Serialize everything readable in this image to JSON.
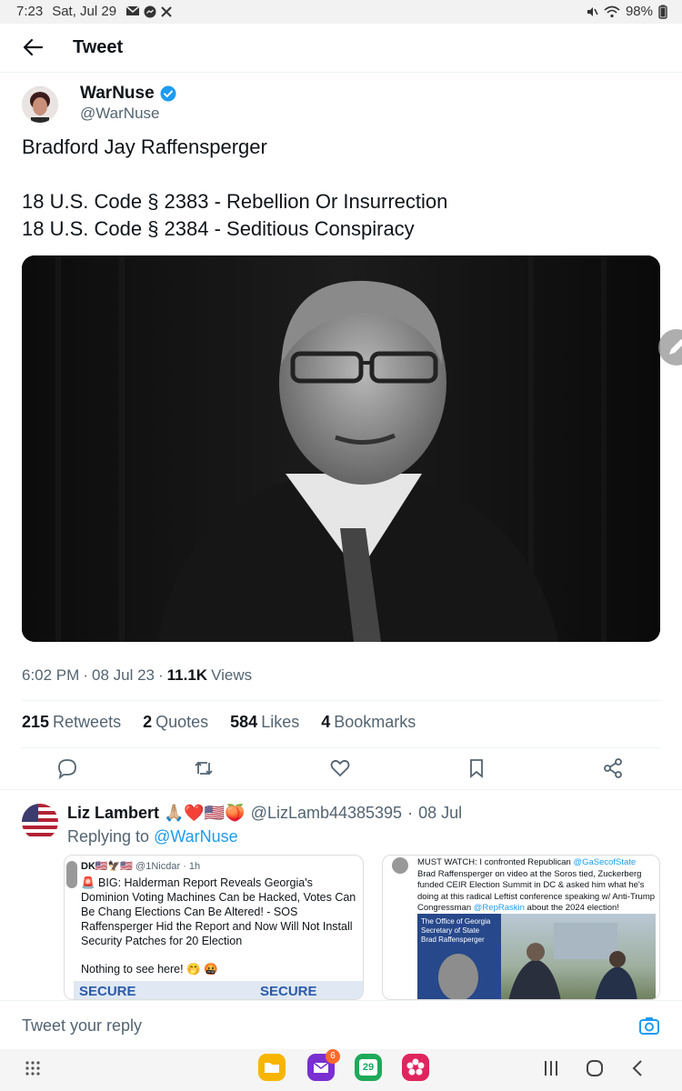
{
  "status_bar": {
    "time": "7:23",
    "date": "Sat, Jul 29",
    "battery": "98%"
  },
  "header": {
    "title": "Tweet"
  },
  "tweet": {
    "author_name": "WarNuse",
    "author_handle": "@WarNuse",
    "text_lines": [
      "Bradford Jay Raffensperger",
      "",
      "18 U.S. Code § 2383 - Rebellion Or Insurrection",
      "18 U.S. Code § 2384 - Seditious Conspiracy"
    ],
    "time": "6:02 PM",
    "date": "08 Jul 23",
    "views_count": "11.1K",
    "views_label": "Views"
  },
  "stats": {
    "retweets_count": "215",
    "retweets_label": "Retweets",
    "quotes_count": "2",
    "quotes_label": "Quotes",
    "likes_count": "584",
    "likes_label": "Likes",
    "bookmarks_count": "4",
    "bookmarks_label": "Bookmarks"
  },
  "reply": {
    "name": "Liz Lambert 🙏🏼❤️🇺🇸🍑",
    "handle": "@LizLamb44385395",
    "date": "08 Jul",
    "replying_prefix": "Replying to",
    "replying_to": "@WarNuse",
    "quote1": {
      "user": "DK🇺🇸🦅🇺🇸",
      "handle": "@1Nicdar",
      "ago": "1h",
      "text": "🚨 BIG: Halderman Report Reveals Georgia's Dominion Voting Machines Can be Hacked, Votes Can Be Chang Elections Can Be Altered! - SOS Raffensperger Hid the Report and Now Will Not Install Security Patches for 20 Election",
      "text2": "Nothing to see here! 🤭 🤬",
      "banner_left": "SECURE",
      "banner_right": "SECURE"
    },
    "quote2": {
      "text_before": "MUST WATCH: I confronted Republican",
      "mention1": "@GaSecofState",
      "text_mid": "Brad Raffensperger on video at the Soros tied, Zuckerberg funded CEIR Election Summit in DC & asked him what he's doing at this radical Leftist conference speaking w/ Anti-Trump Congressman",
      "mention2": "@RepRaskin",
      "text_after": "about the 2024 election!",
      "card_line1": "The Office of Georgia",
      "card_line2": "Secretary of State",
      "card_line3": "Brad Raffensperger"
    }
  },
  "compose": {
    "placeholder": "Tweet your reply"
  },
  "navbar": {
    "mail_badge": "6",
    "calendar_day": "29"
  },
  "colors": {
    "accent": "#1d9bf0",
    "muted": "#536471"
  }
}
